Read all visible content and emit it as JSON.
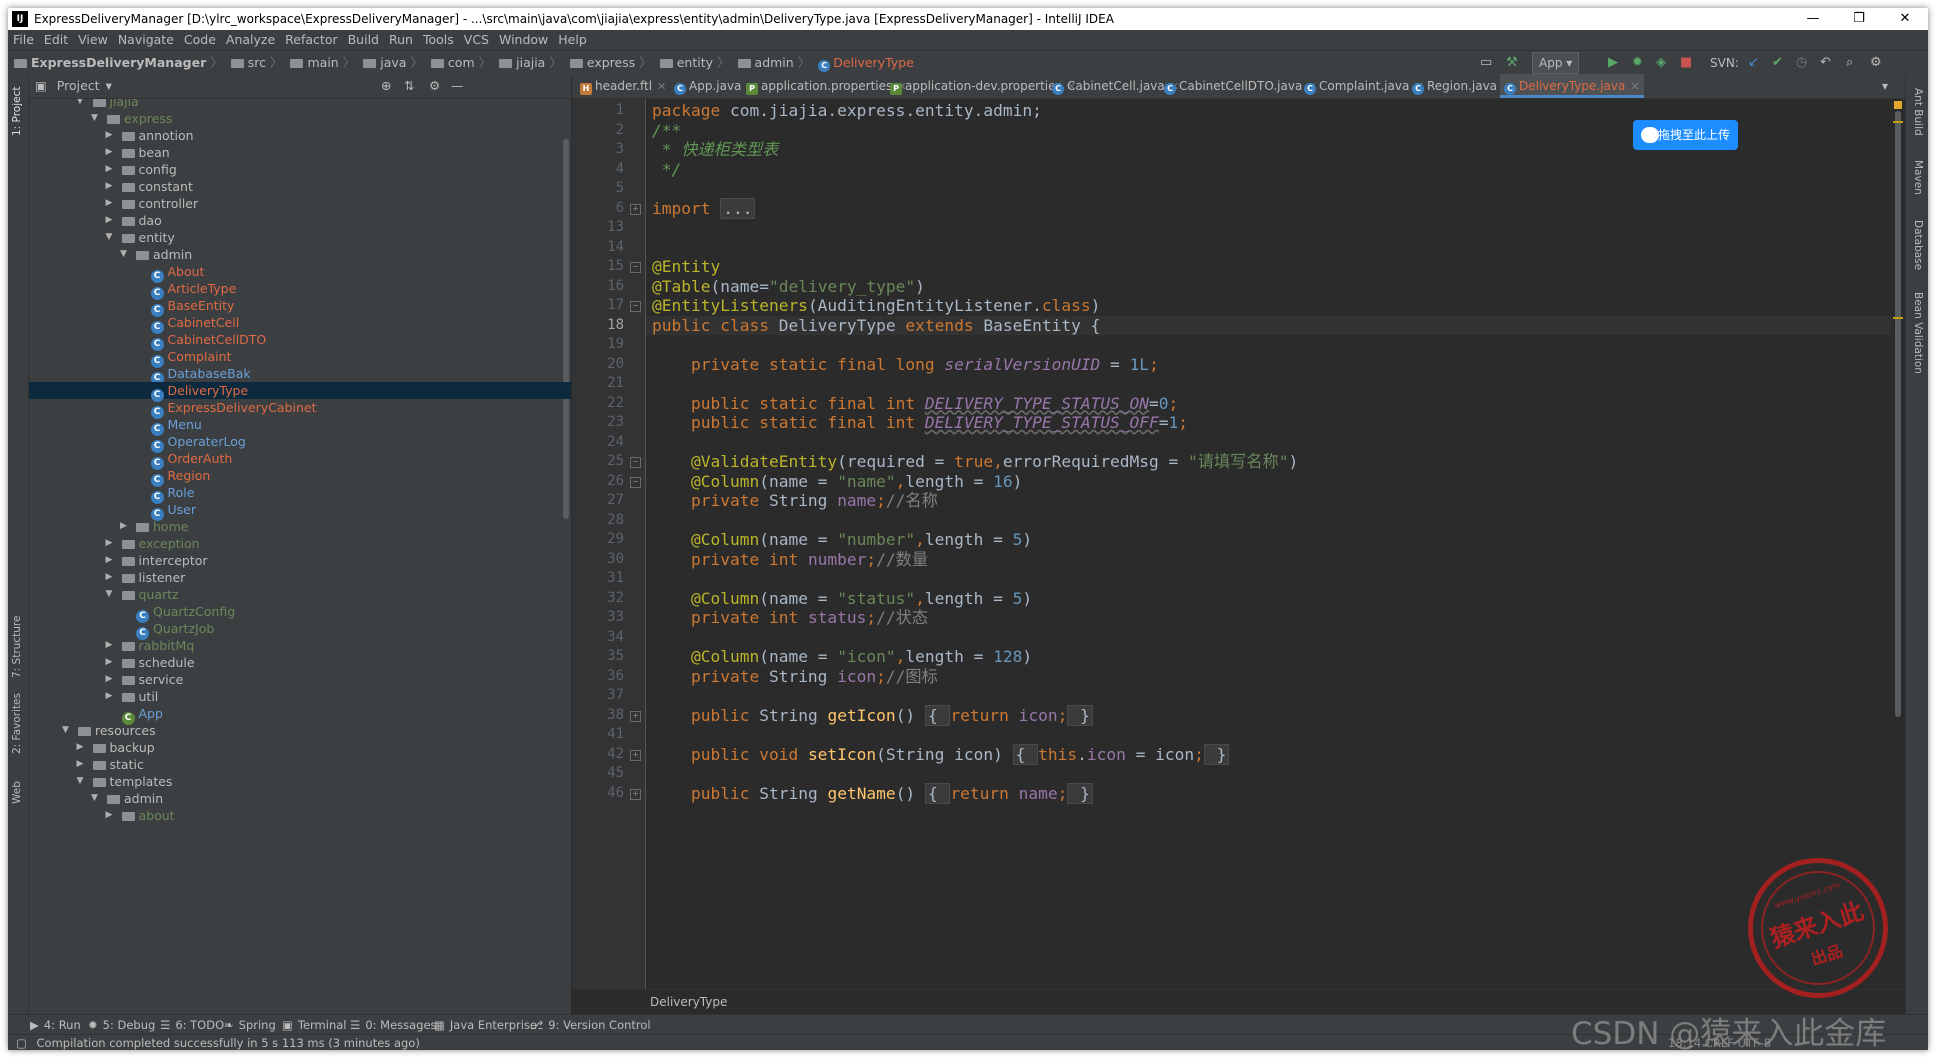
{
  "window": {
    "title": "ExpressDeliveryManager [D:\\ylrc_workspace\\ExpressDeliveryManager] - ...\\src\\main\\java\\com\\jiajia\\express\\entity\\admin\\DeliveryType.java [ExpressDeliveryManager] - IntelliJ IDEA",
    "minimize": "—",
    "maximize": "❐",
    "close": "✕"
  },
  "menu": [
    "File",
    "Edit",
    "View",
    "Navigate",
    "Code",
    "Analyze",
    "Refactor",
    "Build",
    "Run",
    "Tools",
    "VCS",
    "Window",
    "Help"
  ],
  "breadcrumbs": [
    "ExpressDeliveryManager",
    "src",
    "main",
    "java",
    "com",
    "jiajia",
    "express",
    "entity",
    "admin",
    "DeliveryType"
  ],
  "toolbar": {
    "run_config": "App",
    "svn_label": "SVN:"
  },
  "project_panel": {
    "title": "Project"
  },
  "tree": [
    {
      "label": "jiajia",
      "depth": 3,
      "type": "folder",
      "expanded": true,
      "color": "add"
    },
    {
      "label": "express",
      "depth": 4,
      "type": "folder",
      "expanded": true,
      "color": "add"
    },
    {
      "label": "annotion",
      "depth": 5,
      "type": "folder",
      "expanded": false
    },
    {
      "label": "bean",
      "depth": 5,
      "type": "folder",
      "expanded": false
    },
    {
      "label": "config",
      "depth": 5,
      "type": "folder",
      "expanded": false
    },
    {
      "label": "constant",
      "depth": 5,
      "type": "folder",
      "expanded": false
    },
    {
      "label": "controller",
      "depth": 5,
      "type": "folder",
      "expanded": false
    },
    {
      "label": "dao",
      "depth": 5,
      "type": "folder",
      "expanded": false
    },
    {
      "label": "entity",
      "depth": 5,
      "type": "folder",
      "expanded": true
    },
    {
      "label": "admin",
      "depth": 6,
      "type": "folder",
      "expanded": true
    },
    {
      "label": "About",
      "depth": 7,
      "type": "class",
      "color": "mod"
    },
    {
      "label": "ArticleType",
      "depth": 7,
      "type": "class",
      "color": "mod"
    },
    {
      "label": "BaseEntity",
      "depth": 7,
      "type": "class",
      "color": "mod"
    },
    {
      "label": "CabinetCell",
      "depth": 7,
      "type": "class",
      "color": "mod"
    },
    {
      "label": "CabinetCellDTO",
      "depth": 7,
      "type": "class",
      "color": "mod"
    },
    {
      "label": "Complaint",
      "depth": 7,
      "type": "class",
      "color": "mod"
    },
    {
      "label": "DatabaseBak",
      "depth": 7,
      "type": "class",
      "color": "clsblue"
    },
    {
      "label": "DeliveryType",
      "depth": 7,
      "type": "class",
      "color": "mod",
      "selected": true
    },
    {
      "label": "ExpressDeliveryCabinet",
      "depth": 7,
      "type": "class",
      "color": "mod"
    },
    {
      "label": "Menu",
      "depth": 7,
      "type": "class",
      "color": "clsblue"
    },
    {
      "label": "OperaterLog",
      "depth": 7,
      "type": "class",
      "color": "clsblue"
    },
    {
      "label": "OrderAuth",
      "depth": 7,
      "type": "class",
      "color": "mod"
    },
    {
      "label": "Region",
      "depth": 7,
      "type": "class",
      "color": "mod"
    },
    {
      "label": "Role",
      "depth": 7,
      "type": "class",
      "color": "clsblue"
    },
    {
      "label": "User",
      "depth": 7,
      "type": "class",
      "color": "clsblue"
    },
    {
      "label": "home",
      "depth": 6,
      "type": "folder",
      "expanded": false,
      "color": "add"
    },
    {
      "label": "exception",
      "depth": 5,
      "type": "folder",
      "expanded": false,
      "color": "add"
    },
    {
      "label": "interceptor",
      "depth": 5,
      "type": "folder",
      "expanded": false
    },
    {
      "label": "listener",
      "depth": 5,
      "type": "folder",
      "expanded": false
    },
    {
      "label": "quartz",
      "depth": 5,
      "type": "folder",
      "expanded": true,
      "color": "add"
    },
    {
      "label": "QuartzConfig",
      "depth": 6,
      "type": "class",
      "color": "add"
    },
    {
      "label": "QuartzJob",
      "depth": 6,
      "type": "class",
      "color": "add"
    },
    {
      "label": "rabbitMq",
      "depth": 5,
      "type": "folder",
      "expanded": false,
      "color": "add"
    },
    {
      "label": "schedule",
      "depth": 5,
      "type": "folder",
      "expanded": false
    },
    {
      "label": "service",
      "depth": 5,
      "type": "folder",
      "expanded": false
    },
    {
      "label": "util",
      "depth": 5,
      "type": "folder",
      "expanded": false
    },
    {
      "label": "App",
      "depth": 5,
      "type": "class",
      "color": "clsblue"
    },
    {
      "label": "resources",
      "depth": 2,
      "type": "folder",
      "expanded": true
    },
    {
      "label": "backup",
      "depth": 3,
      "type": "folder",
      "expanded": false
    },
    {
      "label": "static",
      "depth": 3,
      "type": "folder",
      "expanded": false
    },
    {
      "label": "templates",
      "depth": 3,
      "type": "folder",
      "expanded": true
    },
    {
      "label": "admin",
      "depth": 4,
      "type": "folder",
      "expanded": true
    },
    {
      "label": "about",
      "depth": 5,
      "type": "folder",
      "expanded": false,
      "color": "add"
    }
  ],
  "tabs": [
    {
      "label": "header.ftl",
      "icon": "h"
    },
    {
      "label": "App.java",
      "icon": "c"
    },
    {
      "label": "application.properties",
      "icon": "g"
    },
    {
      "label": "application-dev.properties",
      "icon": "g"
    },
    {
      "label": "CabinetCell.java",
      "icon": "c"
    },
    {
      "label": "CabinetCellDTO.java",
      "icon": "c"
    },
    {
      "label": "Complaint.java",
      "icon": "c"
    },
    {
      "label": "Region.java",
      "icon": "c"
    },
    {
      "label": "DeliveryType.java",
      "icon": "c",
      "active": true
    }
  ],
  "line_numbers": [
    "1",
    "2",
    "3",
    "4",
    "5",
    "6",
    "13",
    "14",
    "15",
    "16",
    "17",
    "18",
    "19",
    "20",
    "21",
    "22",
    "23",
    "24",
    "25",
    "26",
    "27",
    "28",
    "29",
    "30",
    "31",
    "32",
    "33",
    "34",
    "35",
    "36",
    "37",
    "38",
    "41",
    "42",
    "45",
    "46"
  ],
  "current_line": "18",
  "code": [
    [
      [
        "kw",
        "package "
      ],
      [
        "",
        "com.jiajia.express.entity.admin;"
      ]
    ],
    [
      [
        "com",
        "/**"
      ]
    ],
    [
      [
        "com",
        " * 快递柜类型表"
      ]
    ],
    [
      [
        "com",
        " */"
      ]
    ],
    [],
    [
      [
        "kw",
        "import "
      ],
      [
        "fb",
        "..."
      ]
    ],
    [],
    [],
    [
      [
        "ann",
        "@Entity"
      ]
    ],
    [
      [
        "ann",
        "@Table"
      ],
      [
        "",
        "(name="
      ],
      [
        "str",
        "\"delivery_type\""
      ],
      [
        "",
        ")"
      ]
    ],
    [
      [
        "ann",
        "@EntityListeners"
      ],
      [
        "",
        "(AuditingEntityListener."
      ],
      [
        "kw",
        "class"
      ],
      [
        "",
        ")"
      ]
    ],
    [
      [
        "kw",
        "public class "
      ],
      [
        "",
        "DeliveryType "
      ],
      [
        "kw",
        "extends "
      ],
      [
        "",
        "BaseEntity {"
      ]
    ],
    [],
    [
      [
        "",
        "    "
      ],
      [
        "kw",
        "private static final long "
      ],
      [
        "sfi",
        "serialVersionUID"
      ],
      [
        "",
        " = "
      ],
      [
        "num",
        "1L"
      ],
      [
        "kw",
        ";"
      ]
    ],
    [],
    [
      [
        "",
        "    "
      ],
      [
        "kw",
        "public static final int "
      ],
      [
        "sfu",
        "DELIVERY_TYPE_STATUS_ON"
      ],
      [
        "",
        "="
      ],
      [
        "num",
        "0"
      ],
      [
        "kw",
        ";"
      ]
    ],
    [
      [
        "",
        "    "
      ],
      [
        "kw",
        "public static final int "
      ],
      [
        "sfu",
        "DELIVERY_TYPE_STATUS_OFF"
      ],
      [
        "",
        "="
      ],
      [
        "num",
        "1"
      ],
      [
        "kw",
        ";"
      ]
    ],
    [],
    [
      [
        "",
        "    "
      ],
      [
        "ann",
        "@ValidateEntity"
      ],
      [
        "",
        "(required = "
      ],
      [
        "kw",
        "true"
      ],
      [
        "kw",
        ","
      ],
      [
        "",
        "errorRequiredMsg = "
      ],
      [
        "str",
        "\"请填写名称\""
      ],
      [
        "",
        ")"
      ]
    ],
    [
      [
        "",
        "    "
      ],
      [
        "ann",
        "@Column"
      ],
      [
        "",
        "(name = "
      ],
      [
        "str",
        "\"name\""
      ],
      [
        "kw",
        ","
      ],
      [
        "",
        "length = "
      ],
      [
        "num",
        "16"
      ],
      [
        "",
        ")"
      ]
    ],
    [
      [
        "",
        "    "
      ],
      [
        "kw",
        "private "
      ],
      [
        "",
        "String "
      ],
      [
        "fld",
        "name"
      ],
      [
        "kw",
        ";"
      ],
      [
        "lc",
        "//名称"
      ]
    ],
    [],
    [
      [
        "",
        "    "
      ],
      [
        "ann",
        "@Column"
      ],
      [
        "",
        "(name = "
      ],
      [
        "str",
        "\"number\""
      ],
      [
        "kw",
        ","
      ],
      [
        "",
        "length = "
      ],
      [
        "num",
        "5"
      ],
      [
        "",
        ")"
      ]
    ],
    [
      [
        "",
        "    "
      ],
      [
        "kw",
        "private int "
      ],
      [
        "fld",
        "number"
      ],
      [
        "kw",
        ";"
      ],
      [
        "lc",
        "//数量"
      ]
    ],
    [],
    [
      [
        "",
        "    "
      ],
      [
        "ann",
        "@Column"
      ],
      [
        "",
        "(name = "
      ],
      [
        "str",
        "\"status\""
      ],
      [
        "kw",
        ","
      ],
      [
        "",
        "length = "
      ],
      [
        "num",
        "5"
      ],
      [
        "",
        ")"
      ]
    ],
    [
      [
        "",
        "    "
      ],
      [
        "kw",
        "private int "
      ],
      [
        "fld",
        "status"
      ],
      [
        "kw",
        ";"
      ],
      [
        "lc",
        "//状态"
      ]
    ],
    [],
    [
      [
        "",
        "    "
      ],
      [
        "ann",
        "@Column"
      ],
      [
        "",
        "(name = "
      ],
      [
        "str",
        "\"icon\""
      ],
      [
        "kw",
        ","
      ],
      [
        "",
        "length = "
      ],
      [
        "num",
        "128"
      ],
      [
        "",
        ")"
      ]
    ],
    [
      [
        "",
        "    "
      ],
      [
        "kw",
        "private "
      ],
      [
        "",
        "String "
      ],
      [
        "fld",
        "icon"
      ],
      [
        "kw",
        ";"
      ],
      [
        "lc",
        "//图标"
      ]
    ],
    [],
    [
      [
        "",
        "    "
      ],
      [
        "kw",
        "public "
      ],
      [
        "",
        "String "
      ],
      [
        "fn",
        "getIcon"
      ],
      [
        "",
        "() "
      ],
      [
        "fb",
        "{ "
      ],
      [
        "kw",
        "return "
      ],
      [
        "fld",
        "icon"
      ],
      [
        "kw",
        ";"
      ],
      [
        "fb",
        " }"
      ]
    ],
    [],
    [
      [
        "",
        "    "
      ],
      [
        "kw",
        "public void "
      ],
      [
        "fn",
        "setIcon"
      ],
      [
        "",
        "(String icon) "
      ],
      [
        "fb",
        "{ "
      ],
      [
        "kw",
        "this"
      ],
      [
        "",
        ".",
        ""
      ],
      [
        "fld",
        "icon"
      ],
      [
        "",
        " = icon"
      ],
      [
        "kw",
        ";"
      ],
      [
        "fb",
        " }"
      ]
    ],
    [],
    [
      [
        "",
        "    "
      ],
      [
        "kw",
        "public "
      ],
      [
        "",
        "String "
      ],
      [
        "fn",
        "getName"
      ],
      [
        "",
        "() "
      ],
      [
        "fb",
        "{ "
      ],
      [
        "kw",
        "return "
      ],
      [
        "fld",
        "name"
      ],
      [
        "kw",
        ";"
      ],
      [
        "fb",
        " }"
      ]
    ]
  ],
  "upload_button": "拖拽至此上传",
  "editor_breadcrumb": "DeliveryType",
  "bottom_tools": [
    {
      "icon": "▶",
      "label": "4: Run"
    },
    {
      "icon": "✹",
      "label": "5: Debug"
    },
    {
      "icon": "☰",
      "label": "6: TODO"
    },
    {
      "icon": "❧",
      "label": "Spring"
    },
    {
      "icon": "▣",
      "label": "Terminal"
    },
    {
      "icon": "☰",
      "label": "0: Messages"
    },
    {
      "icon": "▦",
      "label": "Java Enterprise"
    },
    {
      "icon": "⎇",
      "label": "9: Version Control"
    }
  ],
  "status": "Compilation completed successfully in 5 s 113 ms (3 minutes ago)",
  "status_right": "18:14   CRLF   UTF-8",
  "left_stripe": [
    "1: Project",
    "7: Structure",
    "2: Favorites",
    "Web"
  ],
  "right_stripe": [
    "Ant Build",
    "Maven",
    "Database",
    "Bean Validation"
  ],
  "stamp": {
    "url": "www.yuanrc.com",
    "big": "猿来入此",
    "small": "出品"
  },
  "watermark": "CSDN @猿来入此金库"
}
